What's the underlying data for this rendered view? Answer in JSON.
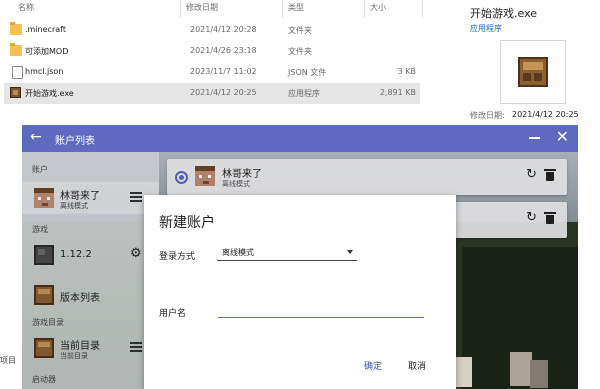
{
  "explorer": {
    "columns": {
      "name": "名称",
      "date": "修改日期",
      "type": "类型",
      "size": "大小"
    },
    "files": [
      {
        "name": ".minecraft",
        "date": "2021/4/12 20:28",
        "type": "文件夹",
        "size": "",
        "icon": "folder-icon",
        "selected": false
      },
      {
        "name": "可添加MOD",
        "date": "2021/4/26 23:18",
        "type": "文件夹",
        "size": "",
        "icon": "folder-icon",
        "selected": false
      },
      {
        "name": "hmcl.json",
        "date": "2023/11/7 11:02",
        "type": "JSON 文件",
        "size": "3 KB",
        "icon": "document-icon",
        "selected": false
      },
      {
        "name": "开始游戏.exe",
        "date": "2021/4/12 20:25",
        "type": "应用程序",
        "size": "2,891 KB",
        "icon": "exe-icon",
        "selected": true
      }
    ],
    "details": {
      "title": "开始游戏.exe",
      "subtitle": "应用程序",
      "modified_label": "修改日期:",
      "modified_value": "2021/4/12 20:25"
    },
    "edge_text": "项目"
  },
  "hmcl": {
    "title": "账户列表",
    "accent_color": "#5c6bc0",
    "sidebar": {
      "section_account": "账户",
      "account": {
        "name": "林哥来了",
        "mode": "离线模式"
      },
      "section_game": "游戏",
      "game_version": "1.12.2",
      "version_list": "版本列表",
      "section_game_dir": "游戏目录",
      "current_dir": "当前目录",
      "current_dir_sub": "当前目录",
      "section_launcher": "启动器"
    },
    "account_card": {
      "name": "林哥来了",
      "mode": "离线模式"
    }
  },
  "dialog": {
    "title": "新建账户",
    "login_method_label": "登录方式",
    "login_method_value": "离线模式",
    "username_label": "用户名",
    "username_value": "",
    "ok_label": "确定",
    "cancel_label": "取消"
  }
}
